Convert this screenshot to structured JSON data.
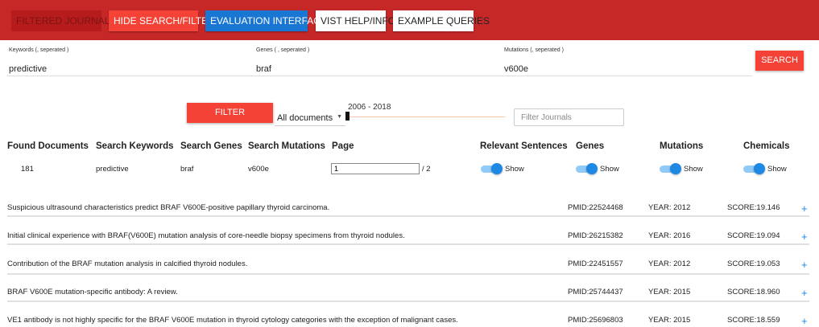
{
  "toolbar": {
    "filtered_journals": "FILTERED JOURNALS",
    "hide_search": "HIDE SEARCH/FILTER",
    "evaluation": "EVALUATION INTERFACE",
    "help": "VIST HELP/INFO",
    "examples": "EXAMPLE QUERIES"
  },
  "search": {
    "keywords_label": "Keywords (, seperated )",
    "keywords_value": "predictive",
    "genes_label": "Genes ( , seperated )",
    "genes_value": "braf",
    "mutations_label": "Mutations (, seperated )",
    "mutations_value": "v600e",
    "search_button": "SEARCH"
  },
  "filter": {
    "filter_button": "FILTER DOCUMENTS",
    "document_select": "All documents",
    "year_range": "2006 - 2018",
    "journal_placeholder": "Filter Journals"
  },
  "summary": {
    "headers": {
      "found": "Found Documents",
      "keywords": "Search Keywords",
      "genes": "Search Genes",
      "mutations": "Search Mutations",
      "page": "Page",
      "relevant": "Relevant Sentences",
      "genes_toggle": "Genes",
      "mutations_toggle": "Mutations",
      "chemicals": "Chemicals"
    },
    "found_count": "181",
    "keywords": "predictive",
    "genes": "braf",
    "mutations": "v600e",
    "page_value": "1",
    "page_total": "/ 2",
    "show_label": "Show"
  },
  "results": [
    {
      "title": "Suspicious ultrasound characteristics predict BRAF V600E-positive papillary thyroid carcinoma.",
      "pmid": "PMID:22524468",
      "year": "YEAR: 2012",
      "score": "SCORE:19.146",
      "expand": "+"
    },
    {
      "title": "Initial clinical experience with BRAF(V600E) mutation analysis of core-needle biopsy specimens from thyroid nodules.",
      "pmid": "PMID:26215382",
      "year": "YEAR: 2016",
      "score": "SCORE:19.094",
      "expand": "+"
    },
    {
      "title": "Contribution of the BRAF mutation analysis in calcified thyroid nodules.",
      "pmid": "PMID:22451557",
      "year": "YEAR: 2012",
      "score": "SCORE:19.053",
      "expand": "+"
    },
    {
      "title": "BRAF V600E mutation-specific antibody: A review.",
      "pmid": "PMID:25744437",
      "year": "YEAR: 2015",
      "score": "SCORE:18.960",
      "expand": "+"
    },
    {
      "title": "VE1 antibody is not highly specific for the BRAF V600E mutation in thyroid cytology categories with the exception of malignant cases.",
      "pmid": "PMID:25696803",
      "year": "YEAR: 2015",
      "score": "SCORE:18.559",
      "expand": "+"
    }
  ],
  "colors": {
    "topbar": "#c62828",
    "button_red": "#f44336",
    "button_blue": "#1976d2",
    "toggle_on": "#1e88e5"
  }
}
